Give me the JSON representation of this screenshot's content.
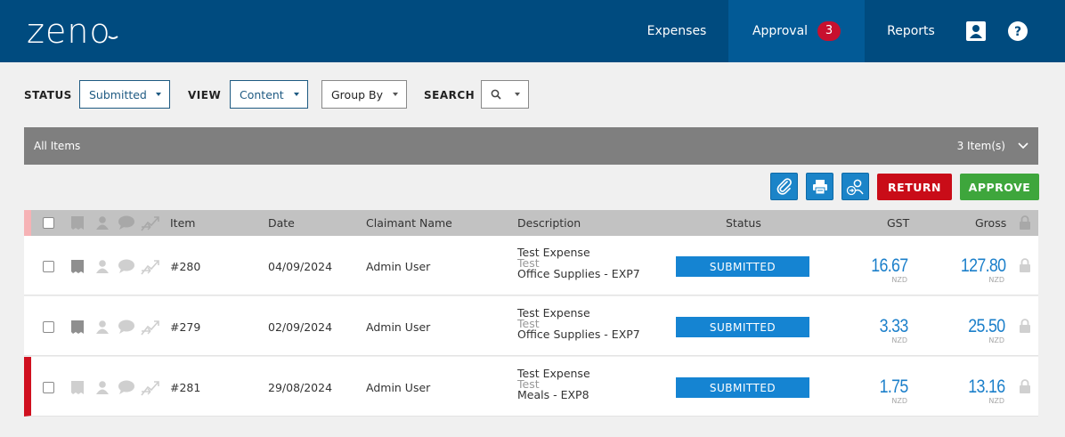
{
  "header": {
    "logo": "zeno",
    "nav": [
      {
        "label": "Expenses"
      },
      {
        "label": "Approval",
        "badge": "3"
      },
      {
        "label": "Reports"
      }
    ]
  },
  "filters": {
    "status_label": "STATUS",
    "status_value": "Submitted",
    "view_label": "VIEW",
    "view_value": "Content",
    "groupby_value": "Group By",
    "search_label": "SEARCH"
  },
  "group": {
    "title": "All Items",
    "count": "3 Item(s)"
  },
  "actions": {
    "return": "RETURN",
    "approve": "APPROVE"
  },
  "columns": {
    "item": "Item",
    "date": "Date",
    "claimant": "Claimant Name",
    "description": "Description",
    "status": "Status",
    "gst": "GST",
    "gross": "Gross"
  },
  "rows": [
    {
      "item": "#280",
      "date": "04/09/2024",
      "claimant": "Admin User",
      "desc1": "Test Expense",
      "desc2": "Test",
      "desc3": "Office Supplies - EXP7",
      "status": "SUBMITTED",
      "gst": "16.67",
      "gst_cur": "NZD",
      "gross": "127.80",
      "gross_cur": "NZD"
    },
    {
      "item": "#279",
      "date": "02/09/2024",
      "claimant": "Admin User",
      "desc1": "Test Expense",
      "desc2": "Test",
      "desc3": "Office Supplies - EXP7",
      "status": "SUBMITTED",
      "gst": "3.33",
      "gst_cur": "NZD",
      "gross": "25.50",
      "gross_cur": "NZD"
    },
    {
      "item": "#281",
      "date": "29/08/2024",
      "claimant": "Admin User",
      "desc1": "Test Expense",
      "desc2": "Test",
      "desc3": "Meals - EXP8",
      "status": "SUBMITTED",
      "gst": "1.75",
      "gst_cur": "NZD",
      "gross": "13.16",
      "gross_cur": "NZD"
    }
  ],
  "colors": {
    "header": "#004b7f",
    "accent": "#1584d2",
    "return": "#c90c18",
    "approve": "#3ea63c",
    "flag": "#d0101f"
  }
}
